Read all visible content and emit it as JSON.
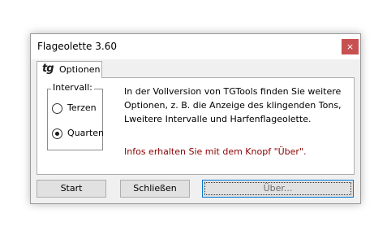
{
  "window": {
    "title": "Flageolette 3.60",
    "close_glyph": "×"
  },
  "tab": {
    "icon_text": "tg",
    "label": "Optionen"
  },
  "interval_group": {
    "label": "Intervall:",
    "options": [
      {
        "label": "Terzen",
        "selected": false
      },
      {
        "label": "Quarten",
        "selected": true
      }
    ]
  },
  "info": {
    "line1": "In der Vollversion von TGTools finden Sie weitere",
    "line2": "Optionen, z. B. die Anzeige des klingenden Tons,",
    "line3": "Lweitere Intervalle und Harfenflageolette.",
    "notice": "Infos erhalten Sie mit dem Knopf \"Über\"."
  },
  "buttons": {
    "start": "Start",
    "close": "Schließen",
    "about": "Über..."
  },
  "colors": {
    "close_button": "#c75050",
    "notice_text": "#8b0000",
    "focus_border": "#0078d7"
  }
}
